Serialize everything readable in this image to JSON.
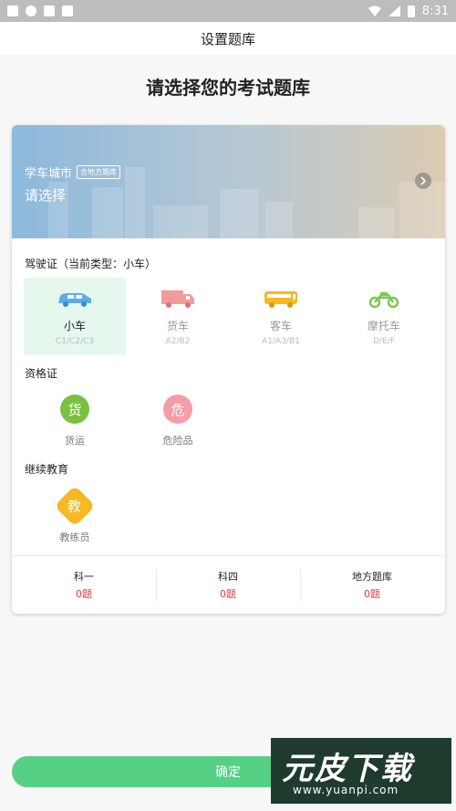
{
  "status_bar": {
    "time": "8:31"
  },
  "header": {
    "title": "设置题库"
  },
  "heading": "请选择您的考试题库",
  "banner": {
    "city": "学车城市",
    "tag": "含地方题库",
    "placeholder": "请选择"
  },
  "license": {
    "title": "驾驶证（当前类型：小车）",
    "items": [
      {
        "name": "小车",
        "sub": "C1/C2/C3",
        "active": true,
        "color": "#5aaee8"
      },
      {
        "name": "货车",
        "sub": "A2/B2",
        "active": false,
        "color": "#f29b9b"
      },
      {
        "name": "客车",
        "sub": "A1/A3/B1",
        "active": false,
        "color": "#f5b921"
      },
      {
        "name": "摩托车",
        "sub": "D/E/F",
        "active": false,
        "color": "#7ac74f"
      }
    ]
  },
  "qualification": {
    "title": "资格证",
    "items": [
      {
        "glyph": "货",
        "label": "货运",
        "color": "#7ac143"
      },
      {
        "glyph": "危",
        "label": "危险品",
        "color": "#f49ca8"
      }
    ]
  },
  "education": {
    "title": "继续教育",
    "items": [
      {
        "glyph": "教",
        "label": "教练员",
        "color": "#f6b824"
      }
    ]
  },
  "stats": [
    {
      "label": "科一",
      "value": "0题"
    },
    {
      "label": "科四",
      "value": "0题"
    },
    {
      "label": "地方题库",
      "value": "0题"
    }
  ],
  "confirm_label": "确定",
  "watermark": {
    "text": "元皮下载",
    "url": "www.yuanpi.com"
  },
  "colors": {
    "accent": "#55d085",
    "red": "#e53935",
    "active_bg": "#e6f8ee"
  }
}
